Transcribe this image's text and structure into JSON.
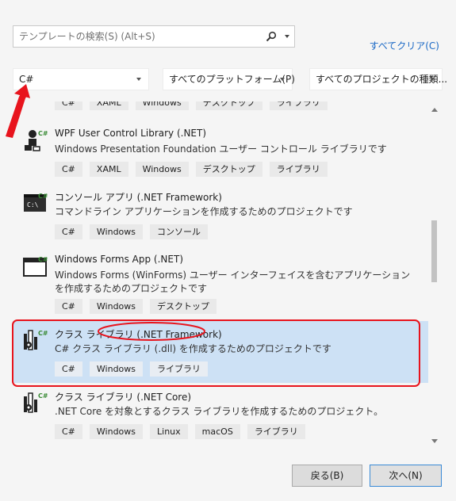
{
  "search": {
    "placeholder": "テンプレートの検索(S) (Alt+S)",
    "value": ""
  },
  "clear_all": "すべてクリア(C)",
  "filters": {
    "language": "C#",
    "platform": "すべてのプラットフォーム(P)",
    "project_type": "すべてのプロジェクトの種類..."
  },
  "templates": [
    {
      "name": "",
      "description": "",
      "tags": [
        "C#",
        "XAML",
        "Windows",
        "デスクトップ",
        "ライブラリ"
      ]
    },
    {
      "name": "WPF User Control Library (.NET)",
      "description": "Windows Presentation Foundation ユーザー コントロール ライブラリです",
      "tags": [
        "C#",
        "XAML",
        "Windows",
        "デスクトップ",
        "ライブラリ"
      ],
      "icon": "wpf-library-icon"
    },
    {
      "name": "コンソール アプリ (.NET Framework)",
      "description": "コマンドライン アプリケーションを作成するためのプロジェクトです",
      "tags": [
        "C#",
        "Windows",
        "コンソール"
      ],
      "icon": "console-icon"
    },
    {
      "name": "Windows Forms App (.NET)",
      "description": "Windows Forms (WinForms) ユーザー インターフェイスを含むアプリケーションを作成するためのプロジェクトです",
      "tags": [
        "C#",
        "Windows",
        "デスクトップ"
      ],
      "icon": "window-icon"
    },
    {
      "name": "クラス ライブラリ (.NET Framework)",
      "description": "C# クラス ライブラリ (.dll) を作成するためのプロジェクトです",
      "tags": [
        "C#",
        "Windows",
        "ライブラリ"
      ],
      "icon": "class-library-icon",
      "selected": true
    },
    {
      "name": "クラス ライブラリ (.NET Core)",
      "description": ".NET Core を対象とするクラス ライブラリを作成するためのプロジェクト。",
      "tags": [
        "C#",
        "Windows",
        "Linux",
        "macOS",
        "ライブラリ"
      ],
      "icon": "class-library-icon"
    }
  ],
  "buttons": {
    "back": "戻る(B)",
    "next": "次へ(N)"
  },
  "colors": {
    "selection": "#cde1f5",
    "link": "#1a68c5",
    "annotation": "#e8141d",
    "csharp_badge": "#388a34"
  }
}
